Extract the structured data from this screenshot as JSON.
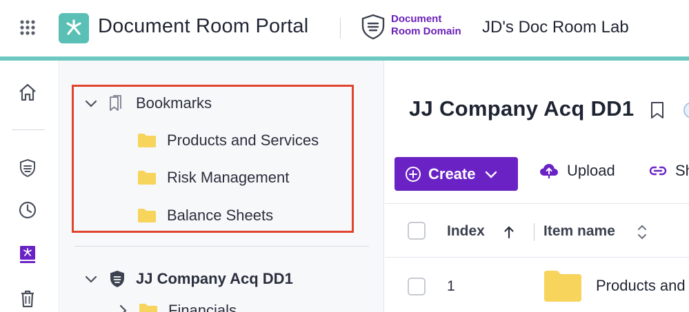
{
  "header": {
    "app_title": "Document Room Portal",
    "domain_label_line1": "Document",
    "domain_label_line2": "Room Domain",
    "workspace_title": "JD's Doc Room Lab"
  },
  "colors": {
    "accent_teal": "#6cc8c0",
    "logo_teal": "#5abfb4",
    "primary_purple": "#6a22c4",
    "highlight_red": "#e0442c",
    "folder_yellow": "#f7d45c"
  },
  "rail": {
    "icons": [
      "home-icon",
      "shield-list-icon",
      "clock-icon",
      "document-room-icon",
      "trash-icon"
    ]
  },
  "tree": {
    "bookmarks_label": "Bookmarks",
    "bookmark_items": [
      {
        "label": "Products and Services"
      },
      {
        "label": "Risk Management"
      },
      {
        "label": "Balance Sheets"
      }
    ],
    "room_label": "JJ Company Acq DD1",
    "room_children": [
      {
        "label": "Financials"
      }
    ]
  },
  "main": {
    "title": "JJ Company Acq DD1",
    "create_label": "Create",
    "upload_label": "Upload",
    "share_label": "Sh",
    "columns": {
      "index": "Index",
      "item_name": "Item name"
    },
    "rows": [
      {
        "index": "1",
        "name": "Products and"
      }
    ]
  }
}
